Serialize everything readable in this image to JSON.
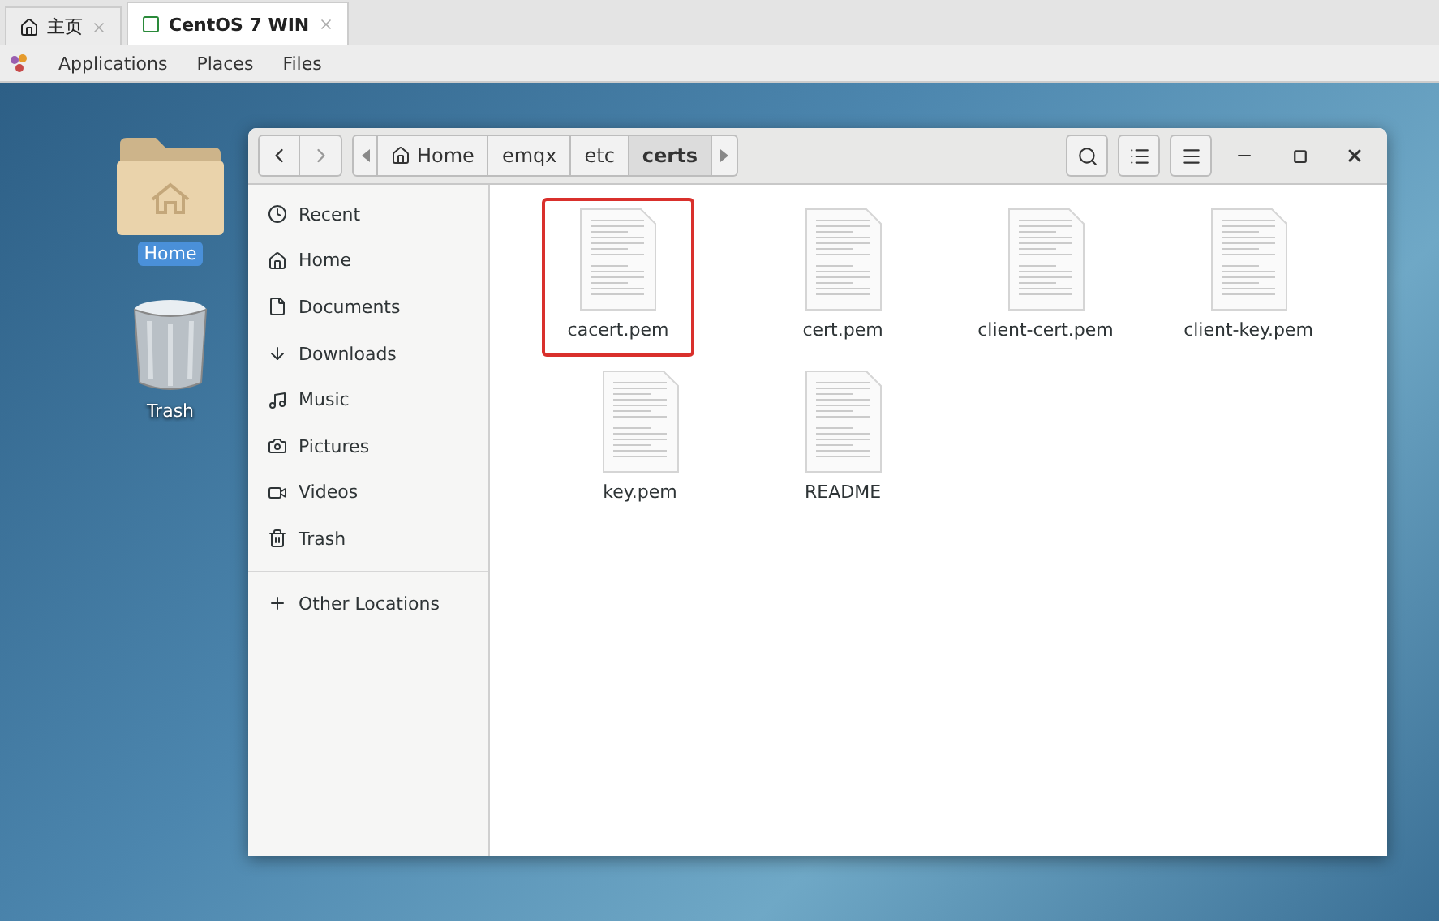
{
  "browser_tabs": [
    {
      "label": "主页",
      "selected": false
    },
    {
      "label": "CentOS 7 WIN",
      "selected": true
    }
  ],
  "menu_bar": [
    "Applications",
    "Places",
    "Files"
  ],
  "desktop_icons": [
    {
      "label": "Home",
      "kind": "folder",
      "selected": true
    },
    {
      "label": "Trash",
      "kind": "trash",
      "selected": false
    }
  ],
  "file_window": {
    "breadcrumbs": [
      {
        "label": "Home",
        "kind": "home",
        "selected": false
      },
      {
        "label": "emqx",
        "kind": "plain",
        "selected": false
      },
      {
        "label": "etc",
        "kind": "plain",
        "selected": false
      },
      {
        "label": "certs",
        "kind": "plain",
        "selected": true
      }
    ],
    "sidebar": [
      "Recent",
      "Home",
      "Documents",
      "Downloads",
      "Music",
      "Pictures",
      "Videos",
      "Trash"
    ],
    "other_locations": "Other Locations",
    "files": [
      {
        "name": "cacert.pem",
        "highlighted": true
      },
      {
        "name": "cert.pem",
        "highlighted": false
      },
      {
        "name": "client-cert.pem",
        "highlighted": false
      },
      {
        "name": "client-key.pem",
        "highlighted": false
      },
      {
        "name": "key.pem",
        "highlighted": false
      },
      {
        "name": "README",
        "highlighted": false
      }
    ]
  }
}
